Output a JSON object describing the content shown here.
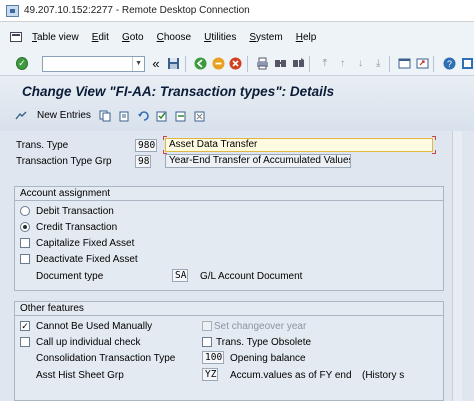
{
  "window": {
    "title": "49.207.10.152:2277 - Remote Desktop Connection"
  },
  "menu": {
    "items": [
      {
        "first": "T",
        "rest": "able view"
      },
      {
        "first": "E",
        "rest": "dit"
      },
      {
        "first": "G",
        "rest": "oto"
      },
      {
        "first": "C",
        "rest": "hoose"
      },
      {
        "first": "U",
        "rest": "tilities"
      },
      {
        "first": "S",
        "rest": "ystem"
      },
      {
        "first": "H",
        "rest": "elp"
      }
    ]
  },
  "toolbar": {
    "command_value": "",
    "history_glyph": "«"
  },
  "page": {
    "title": "Change View \"FI-AA: Transaction types\": Details"
  },
  "appbar": {
    "new_entries": "New Entries"
  },
  "fields": {
    "trans_type": {
      "label": "Trans. Type",
      "code": "980",
      "value": "Asset Data Transfer"
    },
    "trans_type_grp": {
      "label": "Transaction Type Grp",
      "code": "98",
      "value": "Year-End Transfer of Accumulated Values"
    }
  },
  "account_assignment": {
    "title": "Account assignment",
    "debit": "Debit Transaction",
    "credit": "Credit Transaction",
    "capitalize": "Capitalize Fixed Asset",
    "deactivate": "Deactivate Fixed Asset",
    "doc_type_label": "Document type",
    "doc_type_code": "SA",
    "doc_type_text": "G/L Account Document"
  },
  "other_features": {
    "title": "Other features",
    "cannot_manual": "Cannot Be Used Manually",
    "set_changeover": "Set changeover year",
    "call_up": "Call up individual check",
    "obsolete": "Trans. Type Obsolete",
    "consol_label": "Consolidation Transaction Type",
    "consol_code": "100",
    "consol_text": "Opening balance",
    "asst_label": "Asst Hist Sheet Grp",
    "asst_code": "YZ",
    "asst_text": "Accum.values as of FY end",
    "asst_extra": "(History s"
  },
  "colors": {
    "accent": "#0b1c38",
    "ok_green": "#3f9a3f",
    "background": "#dfe6ef"
  }
}
